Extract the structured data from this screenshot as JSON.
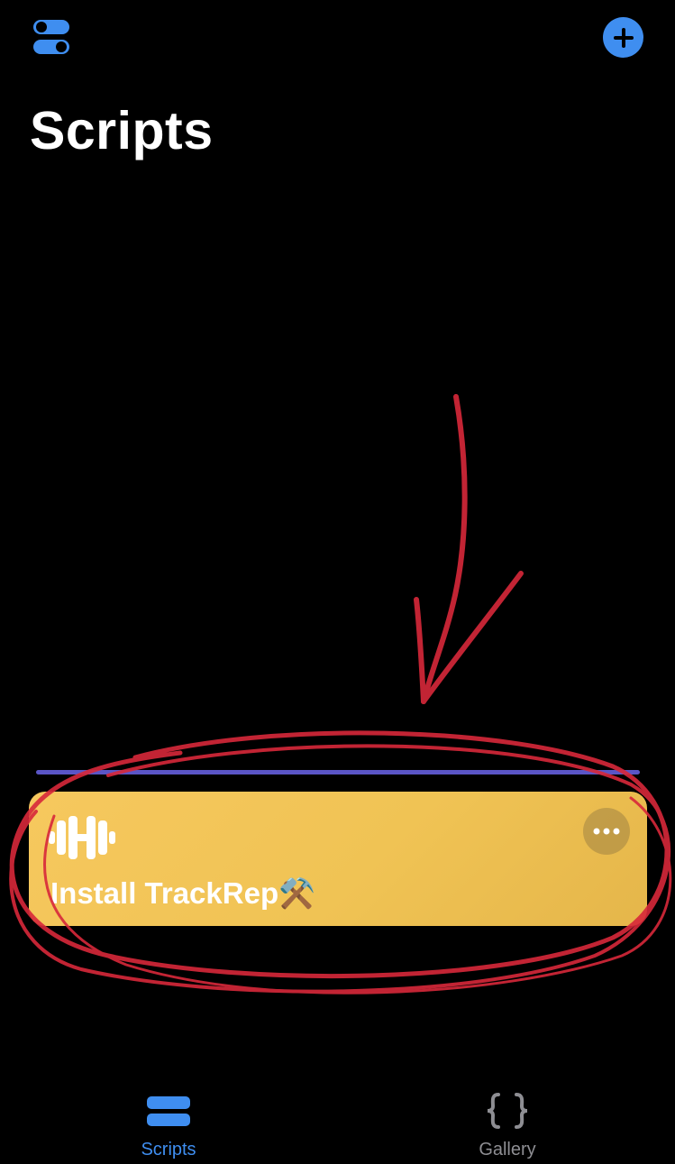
{
  "header": {
    "title": "Scripts",
    "settings_icon": "toggles-icon",
    "add_icon": "plus-circle-icon"
  },
  "colors": {
    "accent": "#3f8ef0",
    "card": "#f2c558",
    "divider": "#5a55c6",
    "annotation": "#d8283a",
    "inactive_tab": "#8e8e93"
  },
  "script_card": {
    "title": "Install TrackRep⚒️",
    "icon": "dumbbell-icon",
    "menu_icon": "ellipsis-icon"
  },
  "tabs": [
    {
      "label": "Scripts",
      "icon": "scripts-stack-icon",
      "selected": true
    },
    {
      "label": "Gallery",
      "icon": "braces-icon",
      "selected": false
    }
  ]
}
